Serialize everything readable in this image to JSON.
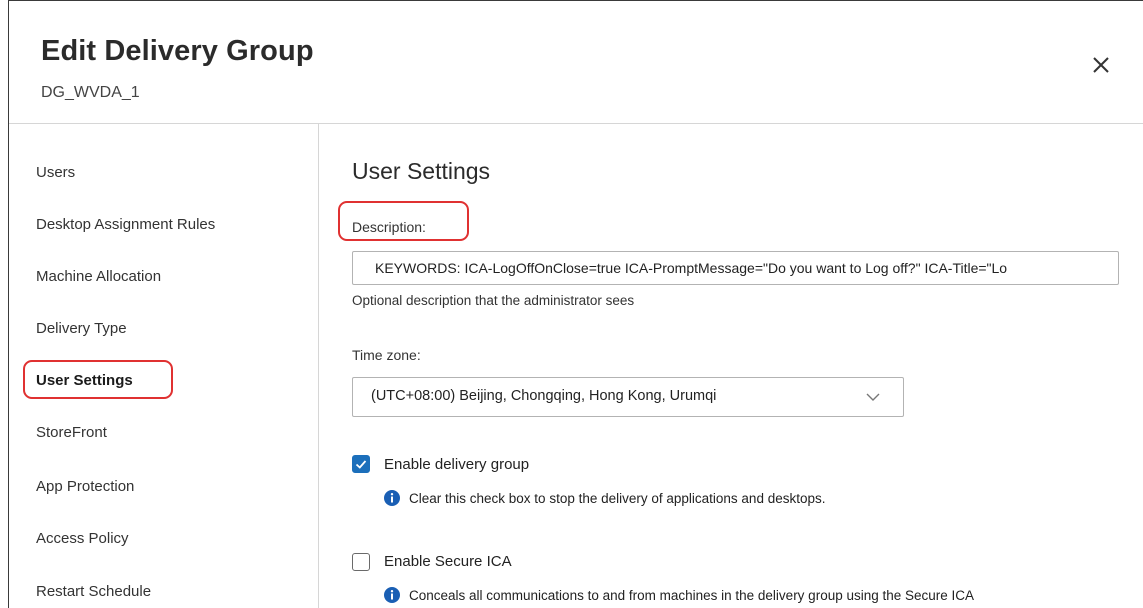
{
  "header": {
    "title": "Edit Delivery Group",
    "subtitle": "DG_WVDA_1"
  },
  "sidebar": {
    "items": [
      {
        "label": "Users"
      },
      {
        "label": "Desktop Assignment Rules"
      },
      {
        "label": "Machine Allocation"
      },
      {
        "label": "Delivery Type"
      },
      {
        "label": "User Settings"
      },
      {
        "label": "StoreFront"
      },
      {
        "label": "App Protection"
      },
      {
        "label": "Access Policy"
      },
      {
        "label": "Restart Schedule"
      }
    ],
    "active": "User Settings"
  },
  "main": {
    "section_title": "User Settings",
    "description": {
      "label": "Description:",
      "value": "KEYWORDS: ICA-LogOffOnClose=true ICA-PromptMessage=\"Do you want to Log off?\" ICA-Title=\"Lo",
      "helper": "Optional description that the administrator sees"
    },
    "timezone": {
      "label": "Time zone:",
      "value": "(UTC+08:00) Beijing, Chongqing, Hong Kong, Urumqi"
    },
    "enable_delivery_group": {
      "label": "Enable delivery group",
      "checked": true,
      "info": "Clear this check box to stop the delivery of applications and desktops."
    },
    "enable_secure_ica": {
      "label": "Enable Secure ICA",
      "checked": false,
      "info": "Conceals all communications to and from machines in the delivery group using the Secure ICA"
    }
  },
  "colors": {
    "accent": "#1c6fbb",
    "highlight": "#e03131",
    "info": "#1a5fb4"
  }
}
